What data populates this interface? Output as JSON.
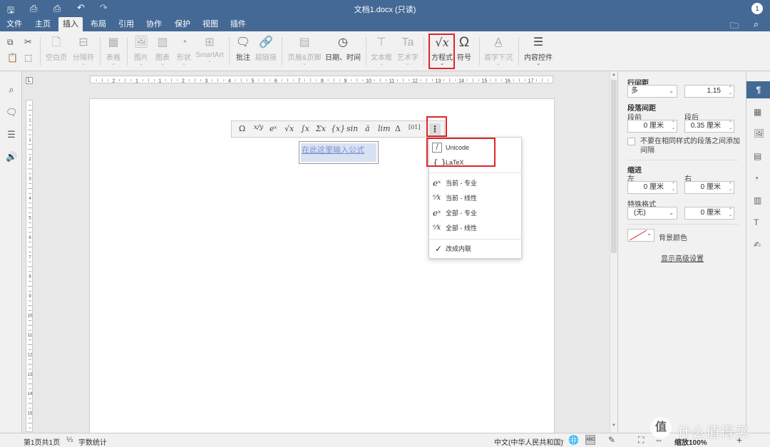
{
  "window": {
    "title": "文档1.docx (只读)",
    "user_badge": "1"
  },
  "menu_tabs": [
    "文件",
    "主页",
    "插入",
    "布局",
    "引用",
    "协作",
    "保护",
    "视图",
    "插件"
  ],
  "active_tab": "插入",
  "ribbon": {
    "blank_page": "空白页",
    "page_break": "分隔符",
    "table": "表格",
    "image": "图片",
    "chart": "图表",
    "shape": "形状",
    "smartart": "SmartArt",
    "comment": "批注",
    "hyperlink": "超链接",
    "header_footer": "页眉&页脚",
    "date_time": "日期、时间",
    "textbox": "文本框",
    "text_art": "艺术字",
    "equation": "方程式",
    "symbol": "符号",
    "drop_cap": "首字下沉",
    "content_control": "内容控件"
  },
  "ruler": {
    "h_numbers": [
      "2",
      "1",
      "1",
      "2",
      "3",
      "4",
      "5",
      "6",
      "7",
      "8",
      "9",
      "10",
      "11",
      "12",
      "13",
      "14",
      "15",
      "16",
      "17"
    ],
    "v_numbers": [
      "1",
      "1",
      "2",
      "3",
      "4",
      "5",
      "6",
      "7",
      "8",
      "9",
      "10",
      "11",
      "12",
      "13",
      "14",
      "15"
    ]
  },
  "equation_toolbar": {
    "buttons": [
      "Ω",
      "x/y",
      "eˣ",
      "√x",
      "∫x",
      "Σx",
      "{x}",
      "sin",
      "ä",
      "lim",
      "Δ",
      "[01]"
    ],
    "more": "⋮"
  },
  "equation_placeholder": "在此这里输入公式",
  "equation_menu": {
    "items": [
      {
        "glyph": "/",
        "label": "Unicode"
      },
      {
        "glyph": "{ }",
        "label": "LaTeX"
      },
      {
        "glyph": "eˣ",
        "label": "当前 - 专业"
      },
      {
        "glyph": "ᵉ⁄x",
        "label": "当前 - 线性"
      },
      {
        "glyph": "eˣ",
        "label": "全部 - 专业"
      },
      {
        "glyph": "ᵉ⁄x",
        "label": "全部 - 线性"
      },
      {
        "glyph": "✓",
        "label": "改成内联"
      }
    ]
  },
  "paragraph_panel": {
    "line_spacing_label": "行间距",
    "line_spacing_mode": "多",
    "line_spacing_value": "1.15",
    "paragraph_spacing_label": "段落间距",
    "before_label": "段前",
    "before_value": "0 厘米",
    "after_label": "段后",
    "after_value": "0.35 厘米",
    "no_space_same_style": "不要在相同样式的段落之间添加间隔",
    "indent_label": "缩进",
    "left_label": "左",
    "left_value": "0 厘米",
    "right_label": "右",
    "right_value": "0 厘米",
    "special_label": "特殊格式",
    "special_value": "(无)",
    "special_amount": "0 厘米",
    "bg_color_label": "背景颜色",
    "advanced_link": "显示高级设置"
  },
  "status_bar": {
    "page_info": "第1页共1页",
    "word_count": "字数统计",
    "language": "中文(中华人民共和国)",
    "zoom": "缩放100%"
  },
  "watermark": {
    "text": "什么值得买",
    "symbol": "值"
  },
  "colors": {
    "header": "#446995",
    "highlight": "#e0252b",
    "ribbon": "#f1f1f1"
  }
}
